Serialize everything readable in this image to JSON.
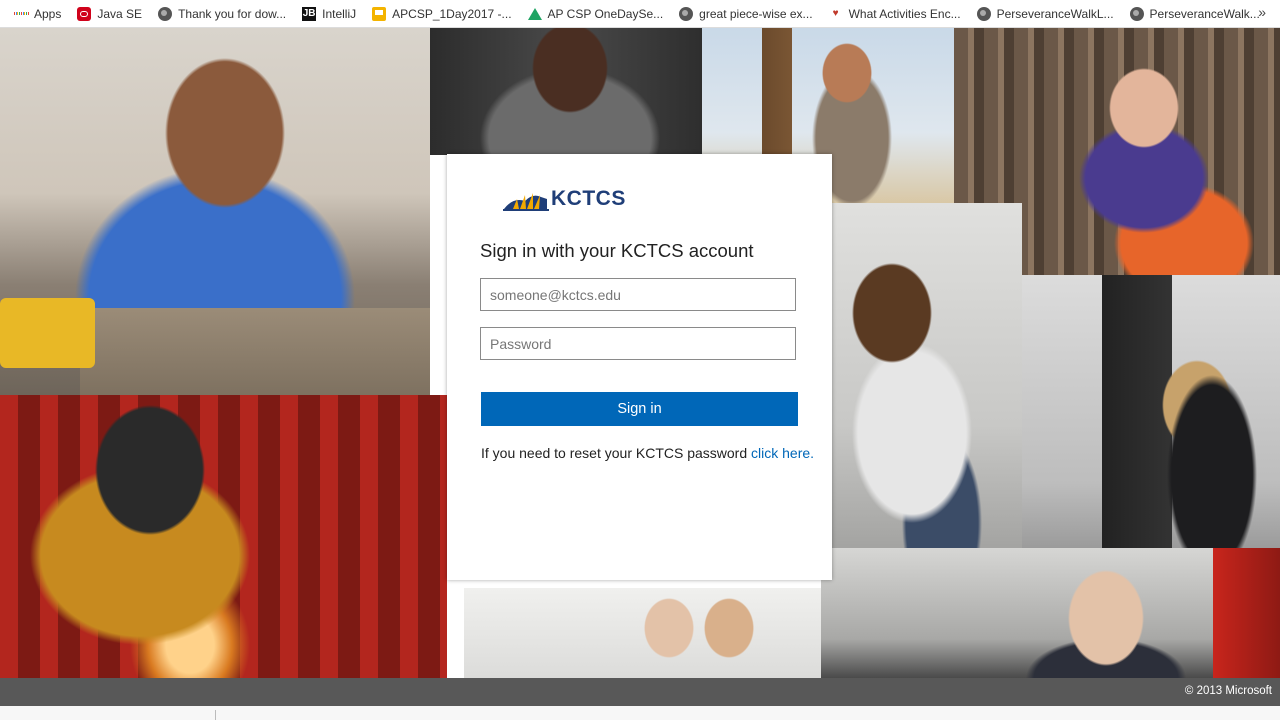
{
  "bookmarks": [
    {
      "label": "Apps",
      "icon": "apps-grid-icon"
    },
    {
      "label": "Java SE",
      "icon": "oracle-icon"
    },
    {
      "label": "Thank you for dow...",
      "icon": "globe-icon"
    },
    {
      "label": "IntelliJ",
      "icon": "jetbrains-icon"
    },
    {
      "label": "APCSP_1Day2017 -...",
      "icon": "google-slides-icon"
    },
    {
      "label": "AP CSP OneDaySe...",
      "icon": "google-drive-icon"
    },
    {
      "label": "great piece-wise ex...",
      "icon": "globe-icon"
    },
    {
      "label": "What Activities Enc...",
      "icon": "heart-shield-icon"
    },
    {
      "label": "PerseveranceWalkL...",
      "icon": "globe-icon"
    },
    {
      "label": "PerseveranceWalk...",
      "icon": "globe-icon"
    }
  ],
  "bookmarks_more": "»",
  "login": {
    "logo_text": "KCTCS",
    "title": "Sign in with your KCTCS account",
    "email_placeholder": "someone@kctcs.edu",
    "password_placeholder": "Password",
    "signin_label": "Sign in",
    "reset_text": "If you need to reset your KCTCS password ",
    "reset_link": "click here."
  },
  "footer": {
    "copyright": "© 2013 Microsoft"
  },
  "colors": {
    "accent": "#0067b8",
    "footer_bg": "#585858",
    "logo_navy": "#1f3e78",
    "logo_gold": "#f2a900"
  }
}
